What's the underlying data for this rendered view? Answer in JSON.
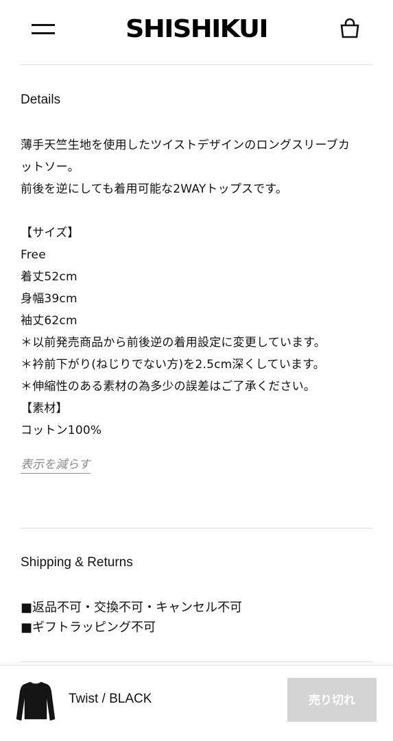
{
  "header": {
    "logo": "SHISHIKUI",
    "menu_icon": "hamburger-menu-icon",
    "cart_icon": "shopping-bag-icon"
  },
  "details": {
    "heading": "Details",
    "lines": [
      "薄手天竺生地を使用したツイストデザインのロングスリーブカ",
      "ットソー。",
      "前後を逆にしても着用可能な2WAYトップスです。",
      "",
      "【サイズ】",
      "Free",
      "着丈52cm",
      "身幅39cm",
      "袖丈62cm",
      "＊以前発売商品から前後逆の着用設定に変更しています。",
      "＊衿前下がり(ねじりでない方)を2.5cm深くしています。",
      "＊伸縮性のある素材の為多少の誤差はご了承ください。",
      "【素材】",
      "コットン100%"
    ],
    "collapse_label": "表示を減らす"
  },
  "shipping": {
    "heading": "Shipping & Returns",
    "lines": [
      "■返品不可・交換不可・キャンセル不可",
      "■ギフトラッピング不可"
    ]
  },
  "sticky_bar": {
    "product_name": "Twist / BLACK",
    "button_label": "売り切れ",
    "thumbnail": "black-long-sleeve-top-thumbnail"
  },
  "colors": {
    "text": "#111111",
    "divider": "#dddddd",
    "muted_link": "#8a8a8a",
    "disabled_button": "#d4d4d4"
  }
}
